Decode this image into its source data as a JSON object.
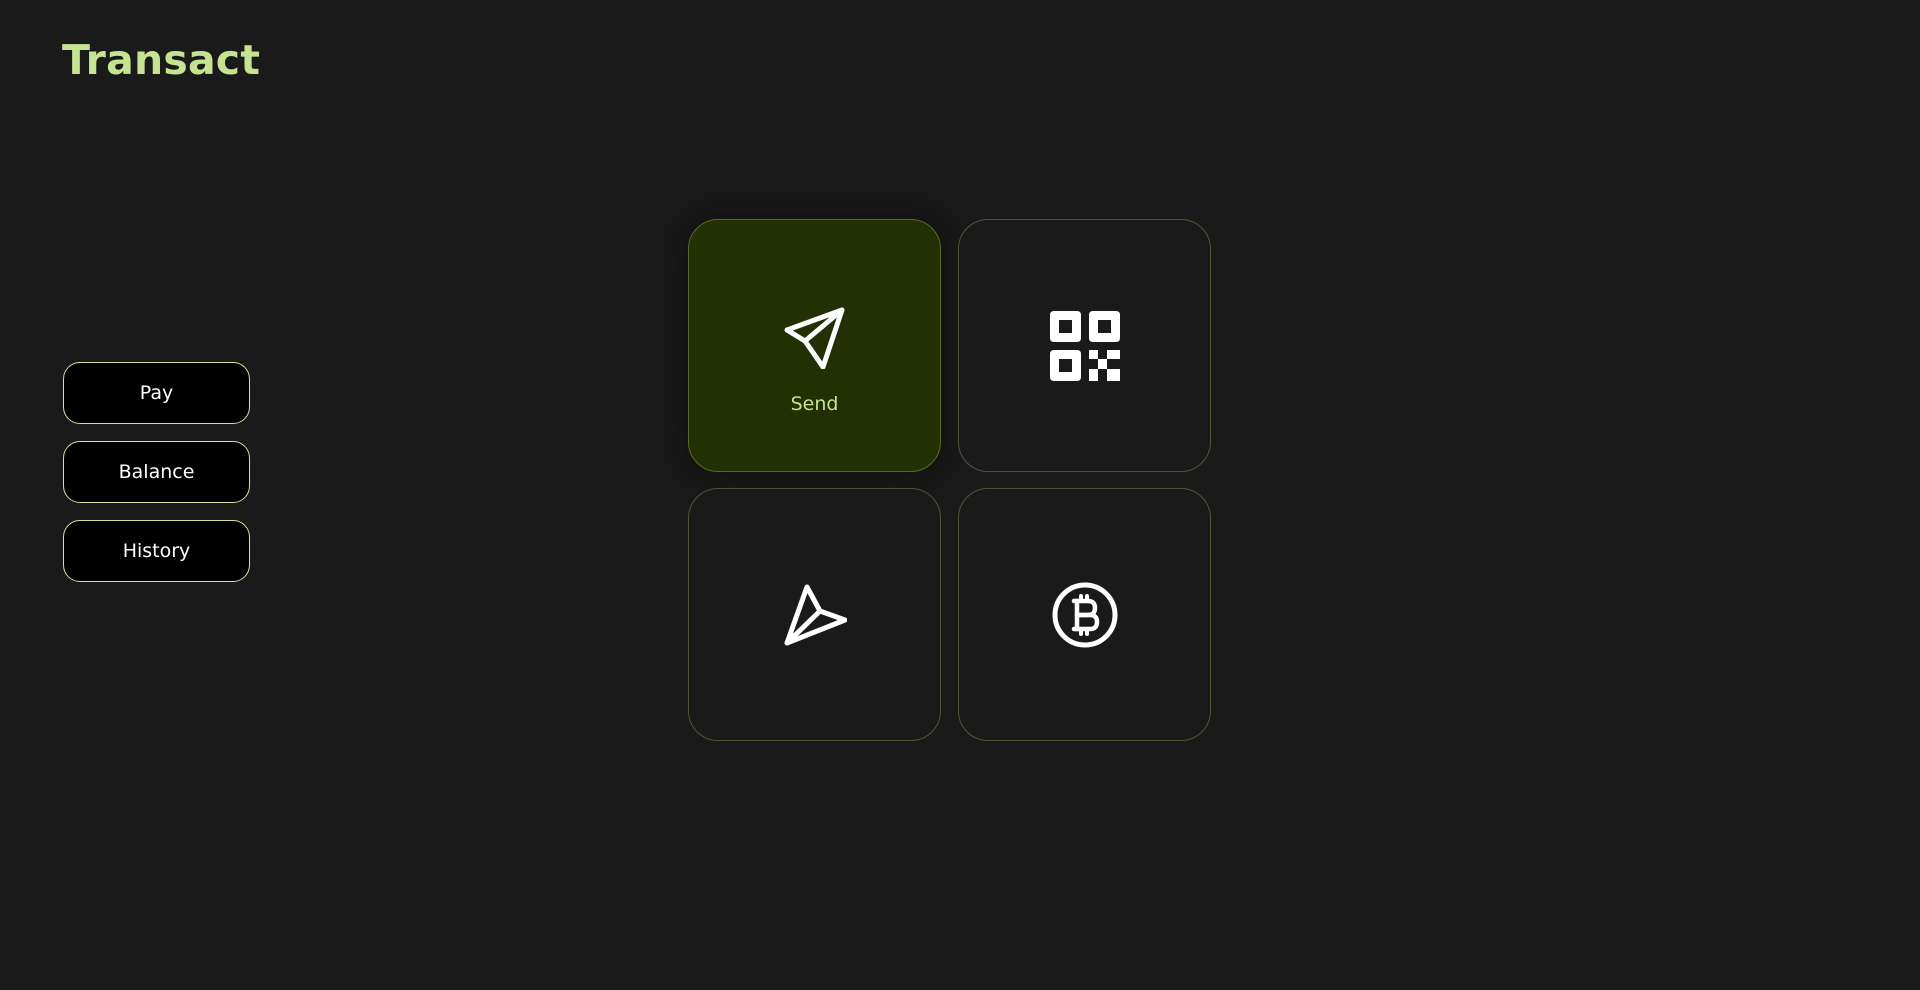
{
  "brand": {
    "title": "Transact",
    "color": "#c5e390"
  },
  "side_nav": {
    "items": [
      {
        "label": "Pay"
      },
      {
        "label": "Balance"
      },
      {
        "label": "History"
      }
    ]
  },
  "tiles": [
    {
      "icon": "send-icon",
      "label": "Send",
      "active": true
    },
    {
      "icon": "qr-code-icon",
      "label": "",
      "active": false
    },
    {
      "icon": "receive-icon",
      "label": "",
      "active": false
    },
    {
      "icon": "bitcoin-icon",
      "label": "",
      "active": false
    }
  ],
  "colors": {
    "background": "#1a1a1a",
    "accent": "#c5e390",
    "active_tile": "#233003"
  }
}
